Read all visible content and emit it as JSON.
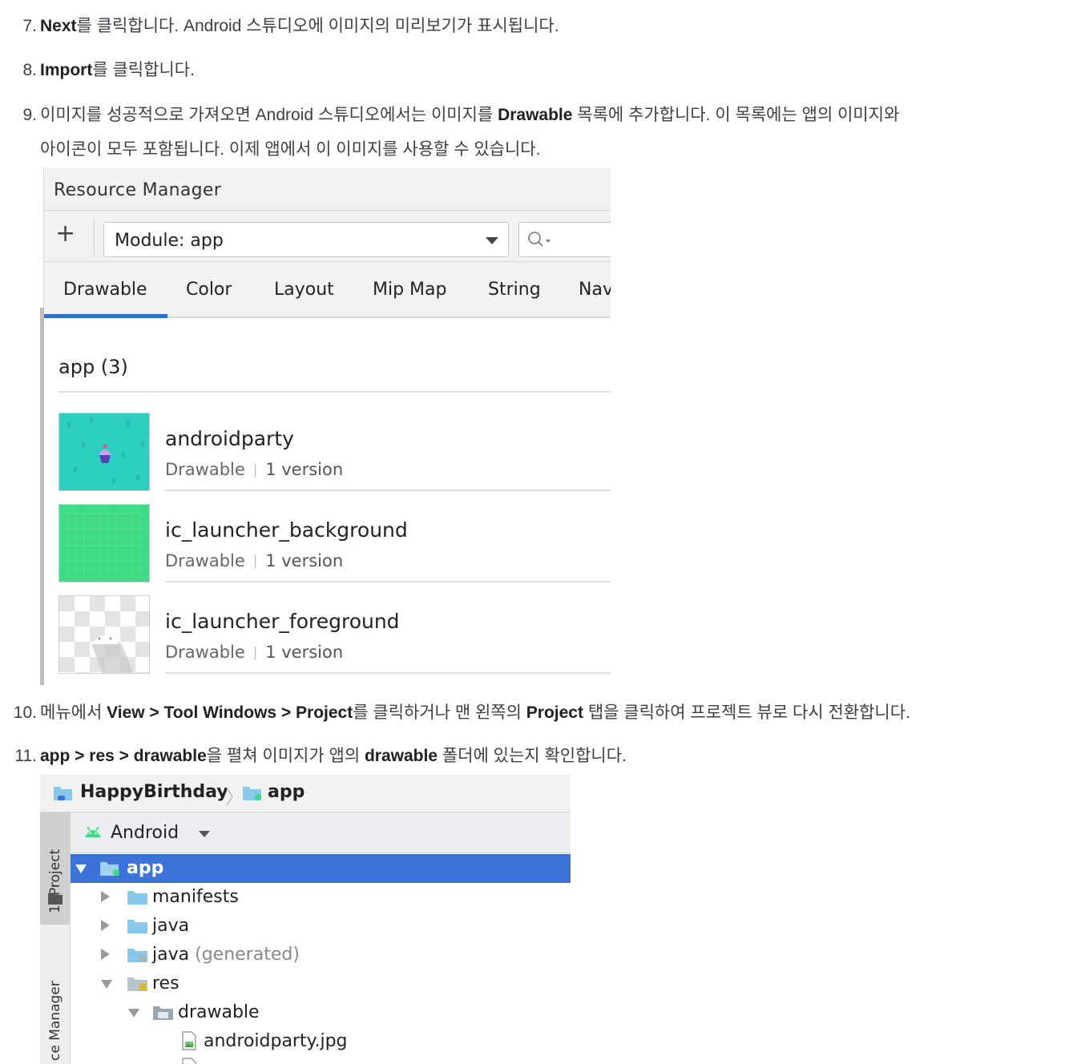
{
  "steps": {
    "s7": {
      "num": "7.",
      "bold": "Next",
      "rest": "를 클릭합니다. Android 스튜디오에 이미지의 미리보기가 표시됩니다."
    },
    "s8": {
      "num": "8.",
      "bold": "Import",
      "rest": "를 클릭합니다."
    },
    "s9": {
      "num": "9.",
      "pre": "이미지를 성공적으로 가져오면 Android 스튜디오에서는 이미지를 ",
      "bold": "Drawable",
      "post": " 목록에 추가합니다. 이 목록에는 앱의 이미지와",
      "line2": "아이콘이 모두 포함됩니다. 이제 앱에서 이 이미지를 사용할 수 있습니다."
    },
    "s10": {
      "num": "10.",
      "pre": "메뉴에서 ",
      "bold1": "View > Tool Windows > Project",
      "mid": "를 클릭하거나 맨 왼쪽의 ",
      "bold2": "Project",
      "post": " 탭을 클릭하여 프로젝트 뷰로 다시 전환합니다."
    },
    "s11": {
      "num": "11.",
      "bold1": "app > res > drawable",
      "mid": "을 펼쳐 이미지가 앱의 ",
      "bold2": "drawable",
      "post": " 폴더에 있는지 확인합니다."
    }
  },
  "resource_manager": {
    "title": "Resource Manager",
    "add_label": "+",
    "module": "Module: app",
    "tabs": [
      "Drawable",
      "Color",
      "Layout",
      "Mip Map",
      "String",
      "Nav"
    ],
    "active_tab": "Drawable",
    "group": "app (3)",
    "items": [
      {
        "name": "androidparty",
        "type": "Drawable",
        "versions": "1 version"
      },
      {
        "name": "ic_launcher_background",
        "type": "Drawable",
        "versions": "1 version"
      },
      {
        "name": "ic_launcher_foreground",
        "type": "Drawable",
        "versions": "1 version"
      }
    ],
    "colors": {
      "tab_underline": "#2d6fd1",
      "party_bg": "#2ccfc0",
      "launcher_bg": "#3ddc84"
    }
  },
  "project": {
    "breadcrumb": [
      "HappyBirthday",
      "app"
    ],
    "side_tabs": [
      "1: Project",
      "ce Manager"
    ],
    "view_label": "Android",
    "tree": [
      {
        "label": "app",
        "selected": true
      },
      {
        "label": "manifests"
      },
      {
        "label": "java"
      },
      {
        "label": "java",
        "suffix": "(generated)"
      },
      {
        "label": "res"
      },
      {
        "label": "drawable"
      },
      {
        "label": "androidparty.jpg"
      }
    ],
    "colors": {
      "selection": "#3b73d9",
      "folder": "#87c9ec"
    }
  }
}
